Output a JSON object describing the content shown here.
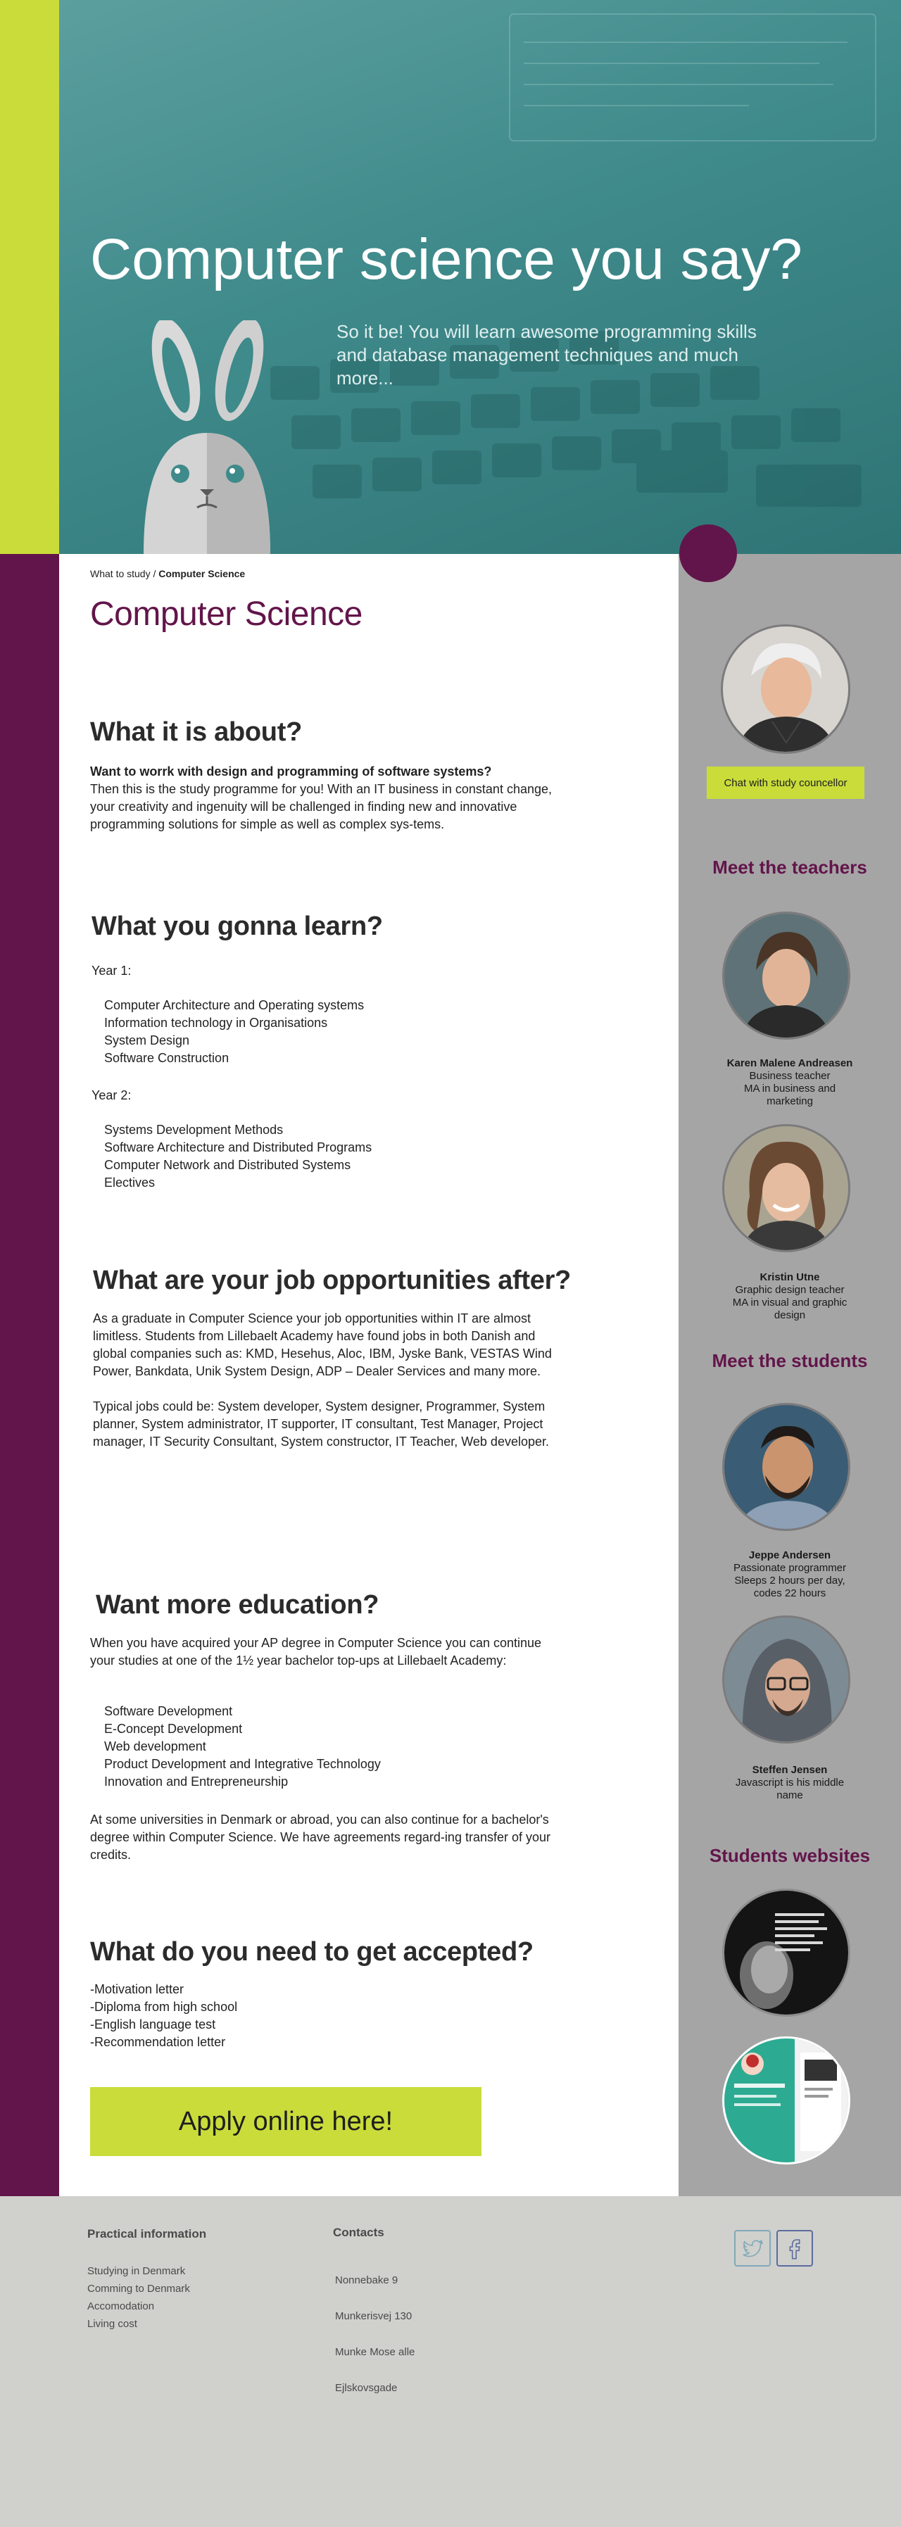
{
  "hero": {
    "title": "Computer science you say?",
    "subtitle": "So it be! You will learn awesome programming skills and database management techniques and much more..."
  },
  "breadcrumb": {
    "parent": "What to study / ",
    "current": "Computer Science"
  },
  "page_title": "Computer Science",
  "about": {
    "heading": "What it is about?",
    "lead": "Want to worrk with design and programming of software systems?",
    "body": "Then this is the study programme for you! With an IT business in constant change, your creativity and ingenuity will be challenged in finding new and innovative programming solutions for simple as well as complex sys-tems."
  },
  "learn": {
    "heading": "What you gonna learn?",
    "year1_label": "Year 1:",
    "year1": [
      "Computer Architecture and Operating systems",
      "Information technology in Organisations",
      "System Design",
      "Software Construction"
    ],
    "year2_label": "Year 2:",
    "year2": [
      "Systems Development Methods",
      "Software Architecture and Distributed Programs",
      "Computer Network and Distributed Systems",
      "Electives"
    ]
  },
  "jobs": {
    "heading": "What are your job opportunities after?",
    "p1": "As a graduate in Computer Science your job opportunities within IT are almost limitless. Students from Lillebaelt Academy have found jobs in both Danish and global companies such as: KMD, Hesehus, Aloc, IBM, Jyske Bank, VESTAS Wind Power, Bankdata, Unik System Design, ADP – Dealer Services and many more.",
    "p2": "Typical jobs could be: System developer, System designer, Programmer, System planner, System administrator, IT supporter, IT consultant, Test Manager, Project manager, IT Security Consultant, System constructor, IT Teacher, Web developer."
  },
  "more_edu": {
    "heading": "Want more education?",
    "p1": "When you have acquired your AP degree in Computer Science you can continue your studies at one of the 1½ year bachelor top-ups at Lillebaelt Academy:",
    "list": [
      "Software Development",
      "E-Concept Development",
      "Web development",
      "Product Development and Integrative Technology",
      "Innovation and Entrepreneurship"
    ],
    "p2": "At some universities in Denmark or abroad, you can also continue for a bachelor's degree within Computer Science. We have agreements regard-ing transfer of your credits."
  },
  "accepted": {
    "heading": "What do you need to get accepted?",
    "list": [
      "-Motivation letter",
      "-Diploma from high school",
      "-English language test",
      "-Recommendation letter"
    ]
  },
  "apply_button": "Apply online here!",
  "sidebar": {
    "chat_button": "Chat with study councellor",
    "teachers_heading": "Meet the teachers",
    "teachers": [
      {
        "name": "Karen Malene Andreasen",
        "lines": [
          "Business teacher",
          "MA in business and",
          "marketing"
        ]
      },
      {
        "name": "Kristin Utne",
        "lines": [
          "Graphic design teacher",
          "MA in visual and graphic",
          "design"
        ]
      }
    ],
    "students_heading": "Meet the students",
    "students": [
      {
        "name": "Jeppe Andersen",
        "lines": [
          "Passionate programmer",
          "Sleeps 2 hours per day,",
          "codes 22 hours"
        ]
      },
      {
        "name": "Steffen Jensen",
        "lines": [
          "Javascript is his middle",
          "name"
        ]
      }
    ],
    "websites_heading": "Students websites"
  },
  "footer": {
    "practical_heading": "Practical information",
    "practical_links": [
      "Studying in Denmark",
      "Comming to Denmark",
      "Accomodation",
      "Living cost"
    ],
    "contacts_heading": "Contacts",
    "contacts": [
      "Nonnebake 9",
      "Munkerisvej 130",
      "Munke Mose alle",
      "Ejlskovsgade"
    ]
  },
  "colors": {
    "lime": "#c9dc3a",
    "purple": "#62154a",
    "teal": "#3f8a8b",
    "sidebar_gray": "#a6a5a6",
    "footer_gray": "#d0d0cd",
    "twitter": "#7fa9b9",
    "facebook": "#5b6c9e"
  },
  "icons": [
    "twitter-icon",
    "facebook-icon"
  ]
}
